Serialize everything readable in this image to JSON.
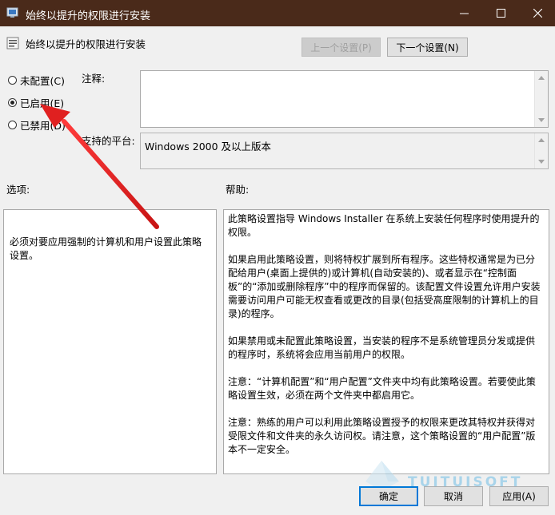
{
  "window": {
    "title": "始终以提升的权限进行安装"
  },
  "header": {
    "title": "始终以提升的权限进行安装"
  },
  "nav": {
    "prev_label": "上一个设置(P)",
    "next_label": "下一个设置(N)"
  },
  "state": {
    "radios": [
      {
        "label": "未配置(C)",
        "selected": false
      },
      {
        "label": "已启用(E)",
        "selected": true
      },
      {
        "label": "已禁用(D)",
        "selected": false
      }
    ]
  },
  "fields": {
    "comment_label": "注释:",
    "comment_value": "",
    "platform_label": "支持的平台:",
    "platform_value": "Windows 2000 及以上版本"
  },
  "sections": {
    "options_label": "选项:",
    "help_label": "帮助:"
  },
  "options": {
    "text": "必须对要应用强制的计算机和用户设置此策略设置。"
  },
  "help": {
    "paragraphs": [
      "此策略设置指导 Windows Installer 在系统上安装任何程序时使用提升的权限。",
      "如果启用此策略设置，则将特权扩展到所有程序。这些特权通常是为已分配给用户(桌面上提供的)或计算机(自动安装的)、或者显示在“控制面板”的“添加或删除程序”中的程序而保留的。该配置文件设置允许用户安装需要访问用户可能无权查看或更改的目录(包括受高度限制的计算机上的目录)的程序。",
      "如果禁用或未配置此策略设置，当安装的程序不是系统管理员分发或提供的程序时，系统将会应用当前用户的权限。",
      "注意：“计算机配置”和“用户配置”文件夹中均有此策略设置。若要使此策略设置生效，必须在两个文件夹中都启用它。",
      "注意：熟练的用户可以利用此策略设置授予的权限来更改其特权并获得对受限文件和文件夹的永久访问权。请注意，这个策略设置的“用户配置”版本不一定安全。"
    ]
  },
  "footer": {
    "ok_label": "确定",
    "cancel_label": "取消",
    "apply_label": "应用(A)"
  },
  "watermark": {
    "text": "TUITUISOFT"
  },
  "colors": {
    "titlebar": "#4a2a1a",
    "focus": "#0078d7",
    "annotation_arrow": "#e02020"
  }
}
